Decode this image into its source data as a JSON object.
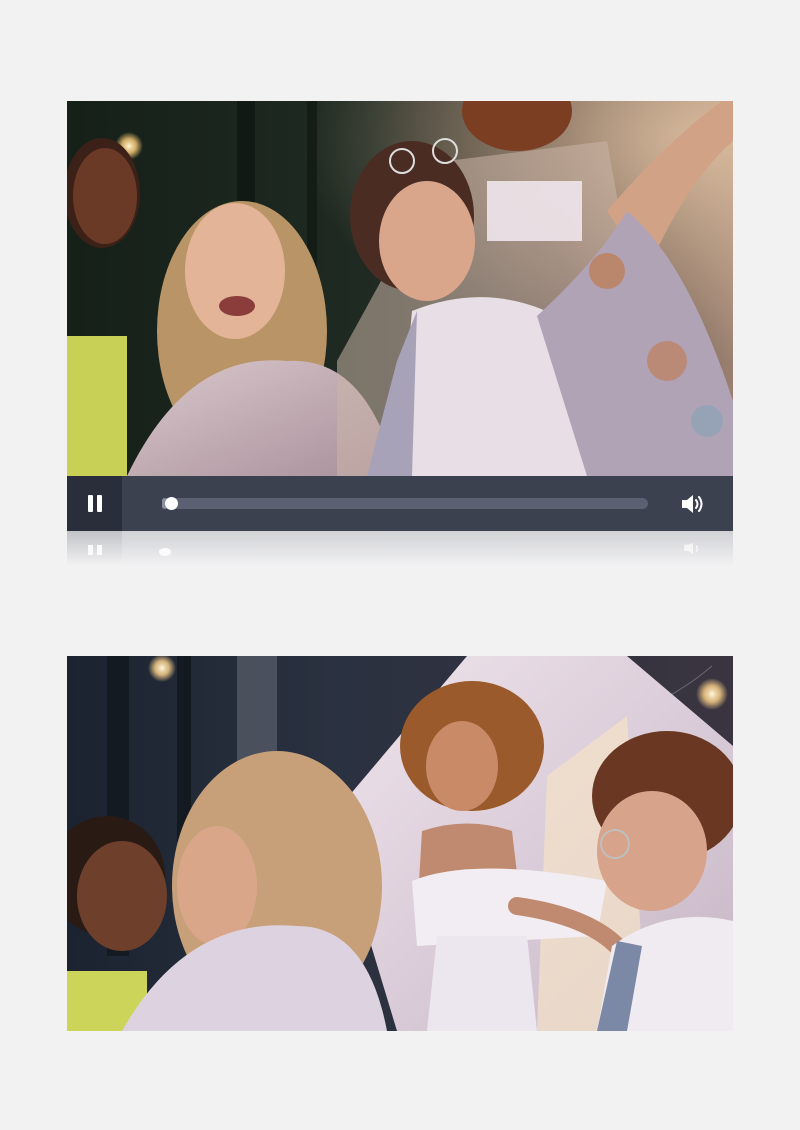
{
  "videos": [
    {
      "scene": "friends-laughing-under-string-lights"
    },
    {
      "scene": "friends-dancing-by-tent"
    }
  ],
  "player": {
    "state": "playing",
    "play_pause_icon": "pause-icon",
    "volume_icon": "volume-icon",
    "progress_fraction": 0.01,
    "colors": {
      "controls_bg": "#3c4150",
      "button_bg": "#2a2e3a",
      "track": "#5b6072",
      "knob": "#ffffff"
    }
  }
}
